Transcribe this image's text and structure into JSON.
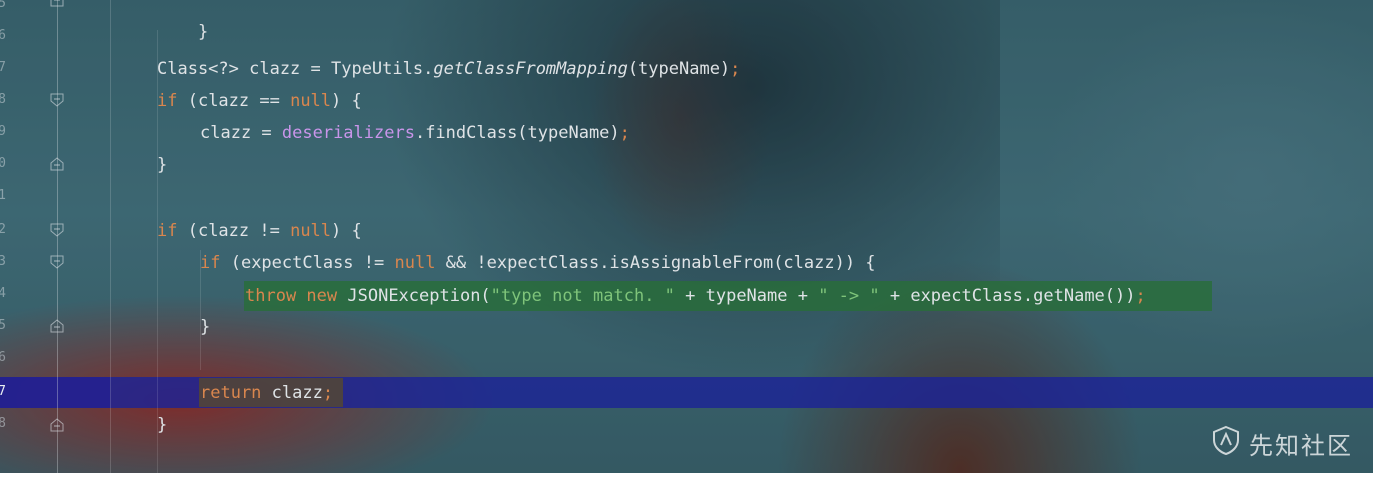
{
  "editor": {
    "line_numbers": [
      "5",
      "6",
      "7",
      "8",
      "9",
      "0",
      "1",
      "2",
      "3",
      "4",
      "5",
      "6",
      "7",
      "8"
    ],
    "active_line_index": 12,
    "code": {
      "l0": {
        "brace": "}"
      },
      "l2": {
        "a": "Class<?> clazz = TypeUtils.",
        "b": "getClassFromMapping",
        "c": "(typeName)",
        "d": ";"
      },
      "l3": {
        "a": "if",
        "b": " (clazz == ",
        "c": "null",
        "d": ") {"
      },
      "l4": {
        "a": "clazz = ",
        "b": "deserializers",
        "c": ".findClass(typeName)",
        "d": ";"
      },
      "l5": {
        "brace": "}"
      },
      "l7": {
        "a": "if",
        "b": " (clazz != ",
        "c": "null",
        "d": ") {"
      },
      "l8": {
        "a": "if",
        "b": " (expectClass != ",
        "c": "null",
        "d": " && !expectClass.isAssignableFrom(clazz)) {"
      },
      "l9": {
        "a": "throw",
        "b": " new",
        "c": " JSONException(",
        "d": "\"type not match. \"",
        "e": " + typeName + ",
        "f": "\" -> \"",
        "g": " + expectClass.getName())",
        "h": ";"
      },
      "l10": {
        "brace": "}"
      },
      "l12": {
        "a": "return",
        "b": " clazz",
        "c": ";"
      },
      "l13": {
        "brace": "}"
      }
    },
    "colors": {
      "keyword": "#d9864e",
      "string": "#7fc47a",
      "field": "#c995ea",
      "text": "#dfe3e6",
      "execution_line": "#1c2396",
      "error_highlight": "#286e37"
    }
  },
  "watermark": {
    "text": "先知社区",
    "icon": "shield-logo-icon"
  }
}
